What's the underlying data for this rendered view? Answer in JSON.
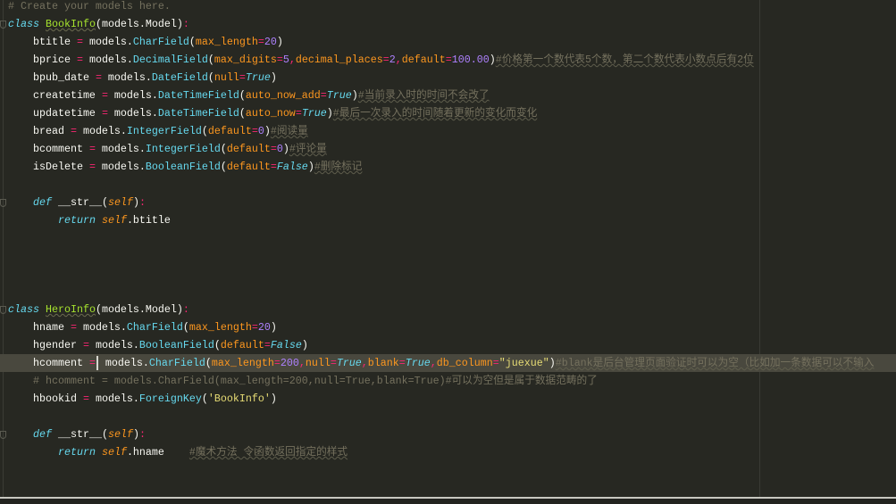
{
  "editor": {
    "current_line": 20,
    "lines": [
      [
        [
          "cm",
          "# Create your models here."
        ]
      ],
      [
        [
          "k",
          "class"
        ],
        [
          "p",
          " "
        ],
        [
          "cn",
          "BookInfo"
        ],
        [
          "p",
          "(models.Model)"
        ],
        [
          "o",
          ":"
        ]
      ],
      [
        [
          "p",
          "    btitle "
        ],
        [
          "o",
          "="
        ],
        [
          "p",
          " models."
        ],
        [
          "f",
          "CharField"
        ],
        [
          "p",
          "("
        ],
        [
          "a",
          "max_length"
        ],
        [
          "o",
          "="
        ],
        [
          "n",
          "20"
        ],
        [
          "p",
          ")"
        ]
      ],
      [
        [
          "p",
          "    bprice "
        ],
        [
          "o",
          "="
        ],
        [
          "p",
          " models."
        ],
        [
          "f",
          "DecimalField"
        ],
        [
          "p",
          "("
        ],
        [
          "a",
          "max_digits"
        ],
        [
          "o",
          "="
        ],
        [
          "n",
          "5"
        ],
        [
          "o",
          ","
        ],
        [
          "a",
          "decimal_places"
        ],
        [
          "o",
          "="
        ],
        [
          "n",
          "2"
        ],
        [
          "o",
          ","
        ],
        [
          "a",
          "default"
        ],
        [
          "o",
          "="
        ],
        [
          "n",
          "100.00"
        ],
        [
          "p",
          ")"
        ],
        [
          "c",
          "#价格第一个数代表5个数，第二个数代表小数点后有2位"
        ]
      ],
      [
        [
          "p",
          "    bpub_date "
        ],
        [
          "o",
          "="
        ],
        [
          "p",
          " models."
        ],
        [
          "f",
          "DateField"
        ],
        [
          "p",
          "("
        ],
        [
          "a",
          "null"
        ],
        [
          "o",
          "="
        ],
        [
          "b",
          "True"
        ],
        [
          "p",
          ")"
        ]
      ],
      [
        [
          "p",
          "    createtime "
        ],
        [
          "o",
          "="
        ],
        [
          "p",
          " models."
        ],
        [
          "f",
          "DateTimeField"
        ],
        [
          "p",
          "("
        ],
        [
          "a",
          "auto_now_add"
        ],
        [
          "o",
          "="
        ],
        [
          "b",
          "True"
        ],
        [
          "p",
          ")"
        ],
        [
          "c",
          "#当前录入时的时间不会改了"
        ]
      ],
      [
        [
          "p",
          "    updatetime "
        ],
        [
          "o",
          "="
        ],
        [
          "p",
          " models."
        ],
        [
          "f",
          "DateTimeField"
        ],
        [
          "p",
          "("
        ],
        [
          "a",
          "auto_now"
        ],
        [
          "o",
          "="
        ],
        [
          "b",
          "True"
        ],
        [
          "p",
          ")"
        ],
        [
          "c",
          "#最后一次录入的时间随着更新的变化而变化"
        ]
      ],
      [
        [
          "p",
          "    bread "
        ],
        [
          "o",
          "="
        ],
        [
          "p",
          " models."
        ],
        [
          "f",
          "IntegerField"
        ],
        [
          "p",
          "("
        ],
        [
          "a",
          "default"
        ],
        [
          "o",
          "="
        ],
        [
          "n",
          "0"
        ],
        [
          "p",
          ")"
        ],
        [
          "c",
          "#阅读量"
        ]
      ],
      [
        [
          "p",
          "    bcomment "
        ],
        [
          "o",
          "="
        ],
        [
          "p",
          " models."
        ],
        [
          "f",
          "IntegerField"
        ],
        [
          "p",
          "("
        ],
        [
          "a",
          "default"
        ],
        [
          "o",
          "="
        ],
        [
          "n",
          "0"
        ],
        [
          "p",
          ")"
        ],
        [
          "c",
          "#评论量"
        ]
      ],
      [
        [
          "p",
          "    isDelete "
        ],
        [
          "o",
          "="
        ],
        [
          "p",
          " models."
        ],
        [
          "f",
          "BooleanField"
        ],
        [
          "p",
          "("
        ],
        [
          "a",
          "default"
        ],
        [
          "o",
          "="
        ],
        [
          "b",
          "False"
        ],
        [
          "p",
          ")"
        ],
        [
          "c",
          "#删除标记"
        ]
      ],
      [],
      [
        [
          "p",
          "    "
        ],
        [
          "k",
          "def"
        ],
        [
          "p",
          " __str__("
        ],
        [
          "s",
          "self"
        ],
        [
          "p",
          ")"
        ],
        [
          "o",
          ":"
        ]
      ],
      [
        [
          "p",
          "        "
        ],
        [
          "k",
          "return"
        ],
        [
          "p",
          " "
        ],
        [
          "s",
          "self"
        ],
        [
          "p",
          ".btitle"
        ]
      ],
      [],
      [],
      [],
      [],
      [
        [
          "k",
          "class"
        ],
        [
          "p",
          " "
        ],
        [
          "cn",
          "HeroInfo"
        ],
        [
          "p",
          "(models.Model)"
        ],
        [
          "o",
          ":"
        ]
      ],
      [
        [
          "p",
          "    hname "
        ],
        [
          "o",
          "="
        ],
        [
          "p",
          " models."
        ],
        [
          "f",
          "CharField"
        ],
        [
          "p",
          "("
        ],
        [
          "a",
          "max_length"
        ],
        [
          "o",
          "="
        ],
        [
          "n",
          "20"
        ],
        [
          "p",
          ")"
        ]
      ],
      [
        [
          "p",
          "    hgender "
        ],
        [
          "o",
          "="
        ],
        [
          "p",
          " models."
        ],
        [
          "f",
          "BooleanField"
        ],
        [
          "p",
          "("
        ],
        [
          "a",
          "default"
        ],
        [
          "o",
          "="
        ],
        [
          "b",
          "False"
        ],
        [
          "p",
          ")"
        ]
      ],
      [
        [
          "p",
          "    hcomment "
        ],
        [
          "o",
          "="
        ],
        [
          "p",
          " models."
        ],
        [
          "f",
          "CharField"
        ],
        [
          "p",
          "("
        ],
        [
          "a",
          "max_length"
        ],
        [
          "o",
          "="
        ],
        [
          "n",
          "200"
        ],
        [
          "o",
          ","
        ],
        [
          "a",
          "null"
        ],
        [
          "o",
          "="
        ],
        [
          "b",
          "True"
        ],
        [
          "o",
          ","
        ],
        [
          "a",
          "blank"
        ],
        [
          "o",
          "="
        ],
        [
          "b",
          "True"
        ],
        [
          "o",
          ","
        ],
        [
          "a",
          "db_column"
        ],
        [
          "o",
          "="
        ],
        [
          "st",
          "\"juexue\""
        ],
        [
          "p",
          ")"
        ],
        [
          "c",
          "#blank是后台管理页面验证时可以为空（比如加一条数据可以不输入"
        ]
      ],
      [
        [
          "c2",
          "    # hcomment = models.CharField(max_length=200,null=True,blank=True)#可以为空但是属于数据范畴的了"
        ]
      ],
      [
        [
          "p",
          "    hbookid "
        ],
        [
          "o",
          "="
        ],
        [
          "p",
          " models."
        ],
        [
          "f",
          "ForeignKey"
        ],
        [
          "p",
          "("
        ],
        [
          "st",
          "'BookInfo'"
        ],
        [
          "p",
          ")"
        ]
      ],
      [],
      [
        [
          "p",
          "    "
        ],
        [
          "k",
          "def"
        ],
        [
          "p",
          " __str__("
        ],
        [
          "s",
          "self"
        ],
        [
          "p",
          ")"
        ],
        [
          "o",
          ":"
        ]
      ],
      [
        [
          "p",
          "        "
        ],
        [
          "k",
          "return"
        ],
        [
          "p",
          " "
        ],
        [
          "s",
          "self"
        ],
        [
          "p",
          ".hname    "
        ],
        [
          "c",
          "#魔术方法 令函数返回指定的样式"
        ]
      ],
      [],
      []
    ]
  }
}
